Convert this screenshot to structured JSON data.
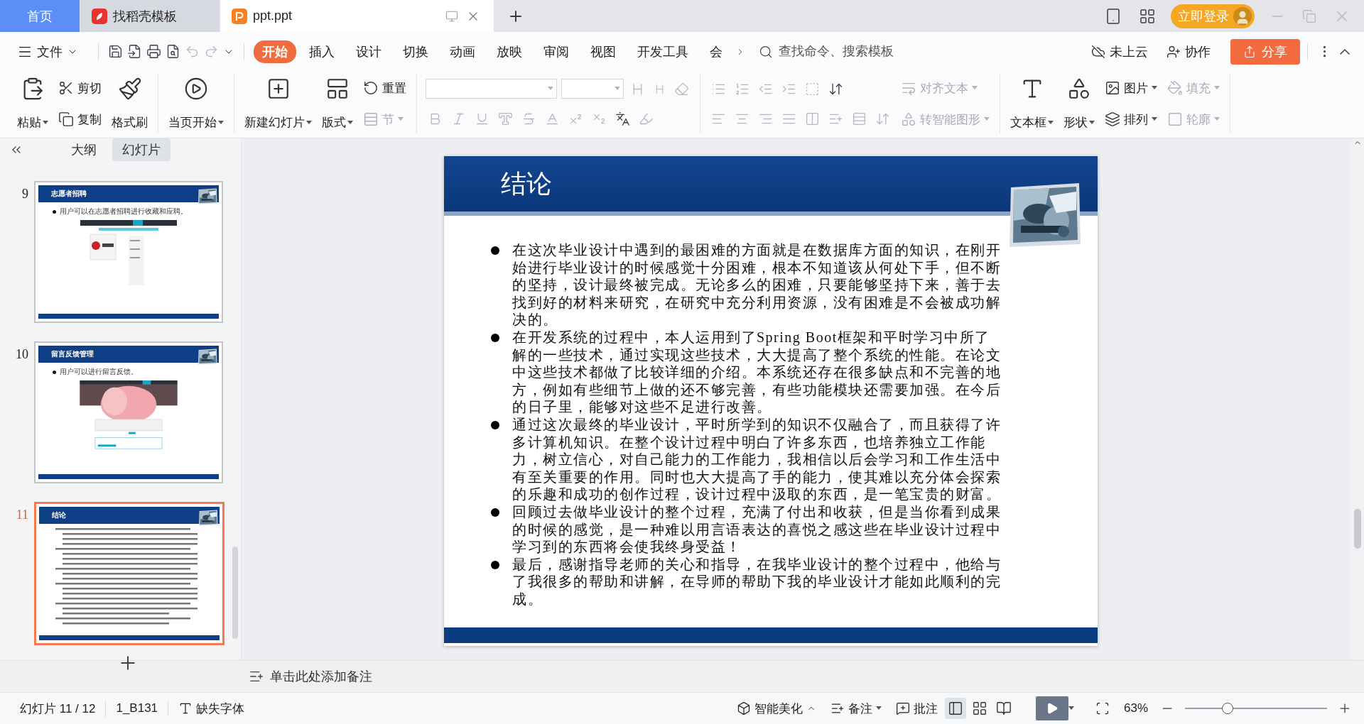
{
  "tabs": [
    {
      "kind": "home",
      "label": "首页",
      "selected": false
    },
    {
      "kind": "template",
      "label": "找稻壳模板",
      "selected": false
    },
    {
      "kind": "presentation",
      "label": "ppt.ppt",
      "selected": true
    }
  ],
  "account": {
    "login": "立即登录"
  },
  "menu": {
    "file": "文件",
    "tabs": [
      {
        "label": "开始",
        "selected": true
      },
      {
        "label": "插入",
        "selected": false
      },
      {
        "label": "设计",
        "selected": false
      },
      {
        "label": "切换",
        "selected": false
      },
      {
        "label": "动画",
        "selected": false
      },
      {
        "label": "放映",
        "selected": false
      },
      {
        "label": "审阅",
        "selected": false
      },
      {
        "label": "视图",
        "selected": false
      },
      {
        "label": "开发工具",
        "selected": false
      },
      {
        "label": "会",
        "selected": false
      }
    ],
    "search": {
      "placeholder": "查找命令、搜索模板"
    },
    "cloud": "未上云",
    "collab": "协作",
    "share": "分享"
  },
  "ribbon": [
    {
      "kind": "buttons",
      "items": [
        {
          "kind": "large",
          "label": "粘贴",
          "dropdown": true,
          "disabled": false
        },
        {
          "kind": "small",
          "label": "剪切",
          "dropdown": false,
          "disabled": false
        },
        {
          "kind": "small",
          "label": "复制",
          "dropdown": false,
          "disabled": false
        },
        {
          "kind": "large",
          "label": "格式刷",
          "dropdown": false,
          "disabled": false
        }
      ]
    },
    {
      "kind": "buttons",
      "items": [
        {
          "kind": "large",
          "label": "当页开始",
          "dropdown": true,
          "disabled": false
        }
      ]
    },
    {
      "kind": "buttons",
      "items": [
        {
          "kind": "large",
          "label": "新建幻灯片",
          "dropdown": true,
          "disabled": false
        },
        {
          "kind": "large",
          "label": "版式",
          "dropdown": true,
          "disabled": false
        },
        {
          "kind": "small",
          "label": "重置",
          "dropdown": false,
          "disabled": false
        },
        {
          "kind": "small",
          "label": "节",
          "dropdown": true,
          "disabled": true
        }
      ]
    },
    {
      "kind": "font"
    },
    {
      "kind": "paragraph",
      "items": [
        {
          "kind": "small",
          "label": "对齐文本",
          "dropdown": true,
          "disabled": true
        },
        {
          "kind": "small",
          "label": "转智能图形",
          "dropdown": true,
          "disabled": true
        }
      ]
    },
    {
      "kind": "buttons",
      "items": [
        {
          "kind": "large",
          "label": "文本框",
          "dropdown": true,
          "disabled": false
        },
        {
          "kind": "large",
          "label": "形状",
          "dropdown": true,
          "disabled": false
        },
        {
          "kind": "small",
          "label": "图片",
          "dropdown": true,
          "disabled": false
        },
        {
          "kind": "small",
          "label": "排列",
          "dropdown": true,
          "disabled": false
        },
        {
          "kind": "small",
          "label": "填充",
          "dropdown": true,
          "disabled": true
        },
        {
          "kind": "small",
          "label": "轮廓",
          "dropdown": true,
          "disabled": true
        }
      ]
    }
  ],
  "panel": {
    "tabs": [
      {
        "label": "大纲",
        "selected": false
      },
      {
        "label": "幻灯片",
        "selected": true
      }
    ],
    "slides": [
      {
        "number": "9",
        "title": "志愿者招聘",
        "bullet": "用户可以在志愿者招聘进行收藏和应聘。",
        "kind": "screenshot",
        "selected": false
      },
      {
        "number": "10",
        "title": "留言反馈管理",
        "bullet": "用户可以进行留言反馈。",
        "kind": "screenshot",
        "selected": false
      },
      {
        "number": "11",
        "title": "结论",
        "kind": "text",
        "selected": true
      }
    ]
  },
  "slide": {
    "title": "结论",
    "bullets": [
      "在这次毕业设计中遇到的最困难的方面就是在数据库方面的知识，在刚开始进行毕业设计的时候感觉十分困难，根本不知道该从何处下手，但不断的坚持，设计最终被完成。无论多么的困难，只要能够坚持下来，善于去找到好的材料来研究，在研究中充分利用资源，没有困难是不会被成功解决的。",
      "在开发系统的过程中，本人运用到了Spring Boot框架和平时学习中所了解的一些技术，通过实现这些技术，大大提高了整个系统的性能。在论文中这些技术都做了比较详细的介绍。本系统还存在很多缺点和不完善的地方，例如有些细节上做的还不够完善，有些功能模块还需要加强。在今后的日子里，能够对这些不足进行改善。",
      "通过这次最终的毕业设计，平时所学到的知识不仅融合了，而且获得了许多计算机知识。在整个设计过程中明白了许多东西，也培养独立工作能力，树立信心，对自己能力的工作能力，我相信以后会学习和工作生活中有至关重要的作用。同时也大大提高了手的能力，使其难以充分体会探索的乐趣和成功的创作过程，设计过程中汲取的东西，是一笔宝贵的财富。",
      "回顾过去做毕业设计的整个过程，充满了付出和收获，但是当你看到成果的时候的感觉，是一种难以用言语表达的喜悦之感这些在毕业设计过程中学习到的东西将会使我终身受益！",
      "最后，感谢指导老师的关心和指导，在我毕业设计的整个过程中，他给与了我很多的帮助和讲解，在导师的帮助下我的毕业设计才能如此顺利的完成。"
    ]
  },
  "notes": {
    "prompt": "单击此处添加备注"
  },
  "status_bar": {
    "slide_counter": "幻灯片 11 / 12",
    "theme": "1_B131",
    "missing_fonts": "缺失字体",
    "beautify": "智能美化",
    "notes": "备注",
    "comments": "批注",
    "views": [
      {
        "selected": true
      },
      {
        "selected": false
      },
      {
        "selected": false
      }
    ],
    "zoom": "63%",
    "zoom_slider": {
      "level": 0.3
    }
  }
}
